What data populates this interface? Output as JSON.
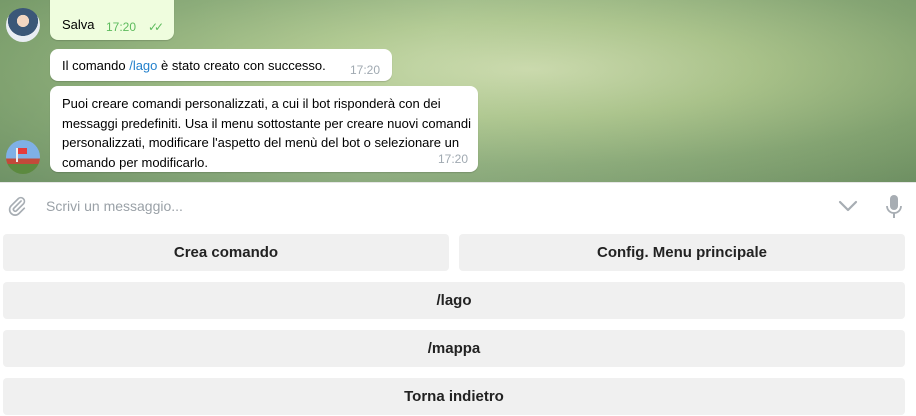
{
  "messages": {
    "outgoing": {
      "text": "Salva",
      "time": "17:20",
      "ticks": "✓✓"
    },
    "bot_created": {
      "prefix": "Il comando ",
      "command": "/lago",
      "suffix": " è stato creato con successo.",
      "time": "17:20"
    },
    "bot_help": {
      "text": "Puoi creare comandi personalizzati, a cui il bot risponderà con dei messaggi predefiniti. Usa il menu sottostante per creare nuovi comandi personalizzati, modificare l'aspetto del menù del bot o selezionare un comando per modificarlo.",
      "time": "17:20"
    }
  },
  "composer": {
    "placeholder": "Scrivi un messaggio...",
    "icons": {
      "attach": "paperclip-icon",
      "keyboard_toggle": "chevron-down-icon",
      "voice": "microphone-icon"
    }
  },
  "keyboard": {
    "row1": {
      "left": "Crea comando",
      "right": "Config. Menu principale"
    },
    "row2": "/lago",
    "row3": "/mappa",
    "row4": "Torna indietro"
  },
  "colors": {
    "outgoing_bubble": "#effdde",
    "incoming_bubble": "#ffffff",
    "link": "#2481cc",
    "check": "#5dbb5d",
    "timestamp": "#a0a9b1",
    "key_button": "#f0f0f0"
  }
}
